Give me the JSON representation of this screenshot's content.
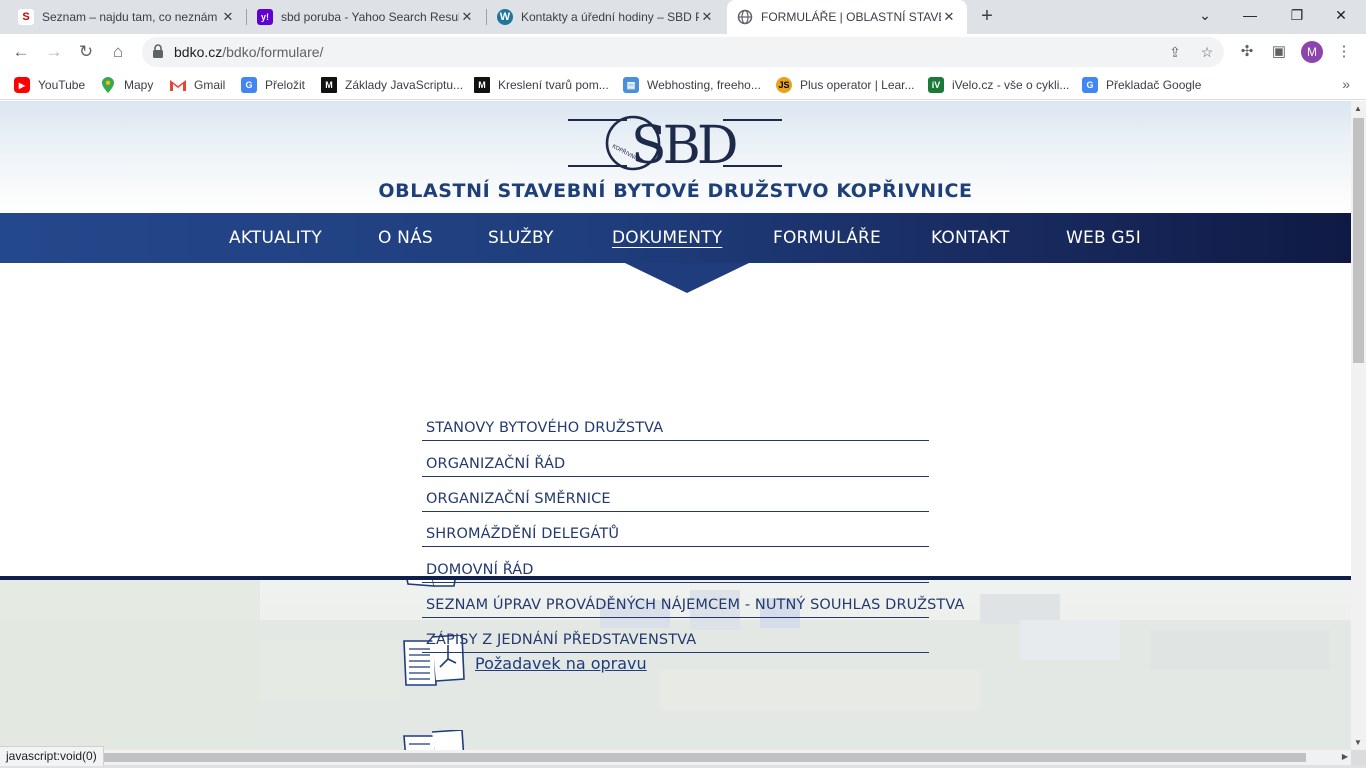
{
  "browser": {
    "tabs": [
      {
        "title": "Seznam – najdu tam, co neznám",
        "favicon": "S",
        "favicon_color": "#cc0000",
        "active": false
      },
      {
        "title": "sbd poruba - Yahoo Search Results",
        "favicon": "y!",
        "favicon_color": "#6001d2",
        "active": false
      },
      {
        "title": "Kontakty a úřední hodiny – SBD Poruba",
        "favicon": "W",
        "favicon_color": "#21759b",
        "active": false
      },
      {
        "title": "FORMULÁŘE | OBLASTNÍ STAVEBNÍ BYTOVÉ",
        "favicon": "globe",
        "favicon_color": "#5f6368",
        "active": true
      }
    ],
    "url_host": "bdko.cz",
    "url_path": "/bdko/formulare/",
    "profile_initial": "M",
    "bookmarks": [
      {
        "label": "YouTube",
        "icon": "youtube-icon",
        "color": "#ff0000"
      },
      {
        "label": "Mapy",
        "icon": "maps-pin-icon",
        "color": "#34a853"
      },
      {
        "label": "Gmail",
        "icon": "gmail-icon",
        "color": "#ea4335"
      },
      {
        "label": "Přeložit",
        "icon": "translate-icon",
        "color": "#4285f4"
      },
      {
        "label": "Základy JavaScriptu...",
        "icon": "m-icon",
        "color": "#111111"
      },
      {
        "label": "Kreslení tvarů pom...",
        "icon": "m-icon",
        "color": "#111111"
      },
      {
        "label": "Webhosting, freeho...",
        "icon": "webhosting-icon",
        "color": "#4a90d9"
      },
      {
        "label": "Plus operator | Lear...",
        "icon": "js-icon",
        "color": "#e8a317"
      },
      {
        "label": "iVelo.cz - vše o cykli...",
        "icon": "ivelo-icon",
        "color": "#1b7a3a"
      },
      {
        "label": "Překladač Google",
        "icon": "translate-icon",
        "color": "#4285f4"
      }
    ],
    "status_text": "javascript:void(0)"
  },
  "site": {
    "logo_text": "CSBD",
    "logo_sub": "KOPŘIVNICE",
    "org_name": "OBLASTNÍ STAVEBNÍ BYTOVÉ DRUŽSTVO KOPŘIVNICE",
    "nav": [
      {
        "label": "AKTUALITY",
        "active": false
      },
      {
        "label": "O NÁS",
        "active": false
      },
      {
        "label": "SLUŽBY",
        "active": false
      },
      {
        "label": "DOKUMENTY",
        "active": true
      },
      {
        "label": "FORMULÁŘE",
        "active": false
      },
      {
        "label": "KONTAKT",
        "active": false
      },
      {
        "label": "WEB G5I",
        "active": false
      }
    ],
    "dropdown": [
      "STANOVY BYTOVÉHO DRUŽSTVA",
      "ORGANIZAČNÍ ŘÁD",
      "ORGANIZAČNÍ SMĚRNICE",
      "SHROMÁŽDĚNÍ DELEGÁTŮ",
      "DOMOVNÍ ŘÁD",
      "SEZNAM ÚPRAV PROVÁDĚNÝCH NÁJEMCEM - NUTNÝ SOUHLAS DRUŽSTVA",
      "ZÁPISY Z JEDNÁNÍ PŘEDSTAVENSTVA"
    ],
    "form_links": [
      "Požadavek na opravu"
    ],
    "colors": {
      "brand_blue": "#1f3d7c",
      "nav_dark": "#0f1a44",
      "text_blue": "#243a6e"
    }
  }
}
